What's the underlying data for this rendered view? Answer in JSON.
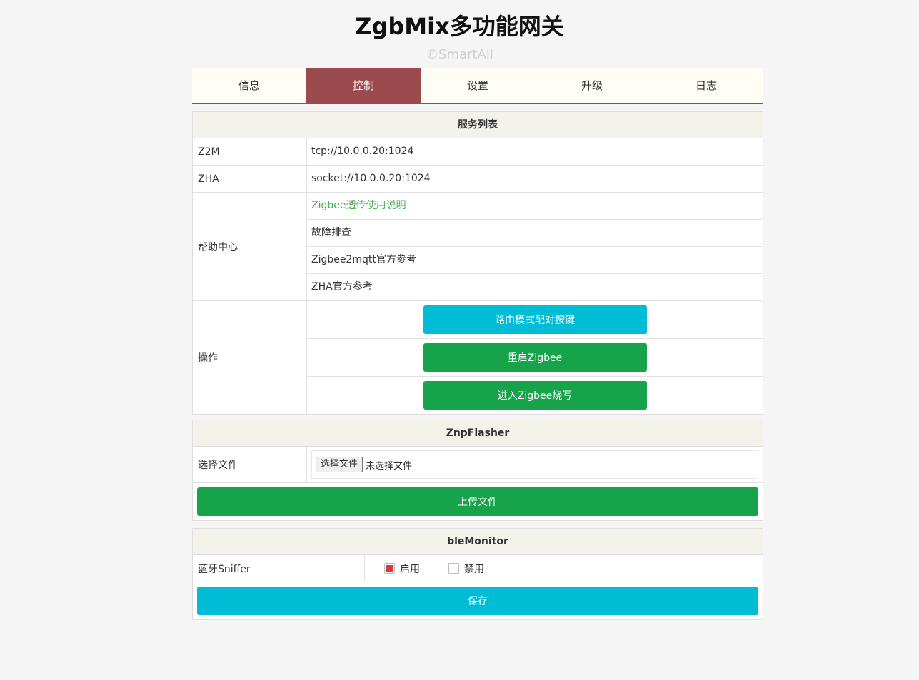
{
  "app": {
    "title": "ZgbMix多功能网关",
    "copyright": "©SmartAll"
  },
  "tabs": [
    {
      "label": "信息",
      "active": false
    },
    {
      "label": "控制",
      "active": true
    },
    {
      "label": "设置",
      "active": false
    },
    {
      "label": "升级",
      "active": false
    },
    {
      "label": "日志",
      "active": false
    }
  ],
  "colors": {
    "accent": "#9b4a4d",
    "primary_cyan": "#00bcd4",
    "primary_green": "#16a34a",
    "link_green": "#4caa55"
  },
  "services": {
    "header": "服务列表",
    "z2m": {
      "label": "Z2M",
      "value": "tcp://10.0.0.20:1024"
    },
    "zha": {
      "label": "ZHA",
      "value": "socket://10.0.0.20:1024"
    },
    "help": {
      "label": "帮助中心",
      "links": [
        "Zigbee透传使用说明",
        "故障排查",
        "Zigbee2mqtt官方参考",
        "ZHA官方参考"
      ]
    },
    "ops": {
      "label": "操作",
      "buttons": [
        "路由模式配对按键",
        "重启Zigbee",
        "进入Zigbee烧写"
      ]
    }
  },
  "znp": {
    "header": "ZnpFlasher",
    "file_label": "选择文件",
    "file_button": "选择文件",
    "file_status": "未选择文件",
    "upload": "上传文件"
  },
  "ble": {
    "header": "bleMonitor",
    "sniffer_label": "蓝牙Sniffer",
    "enable": "启用",
    "disable": "禁用",
    "enabled": true,
    "save": "保存"
  }
}
